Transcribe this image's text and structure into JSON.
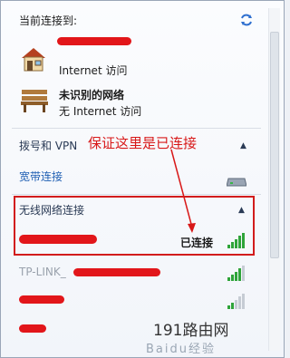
{
  "header": {
    "current_label": "当前连接到:"
  },
  "connections": [
    {
      "status": "Internet 访问"
    },
    {
      "name": "未识别的网络",
      "status": "无 Internet 访问"
    }
  ],
  "sections": {
    "dialup_vpn": "拨号和 VPN",
    "broadband": "宽带连接",
    "wireless": "无线网络连接"
  },
  "annotation": {
    "text": "保证这里是已连接"
  },
  "wifi": [
    {
      "status": "已连接"
    },
    {
      "name": "TP-LINK_"
    }
  ],
  "watermark": {
    "site": "191路由网",
    "baidu": "Baidu经验"
  },
  "colors": {
    "annotation": "#d81818",
    "signal": "#2fa43a",
    "link": "#1f5fb3"
  }
}
